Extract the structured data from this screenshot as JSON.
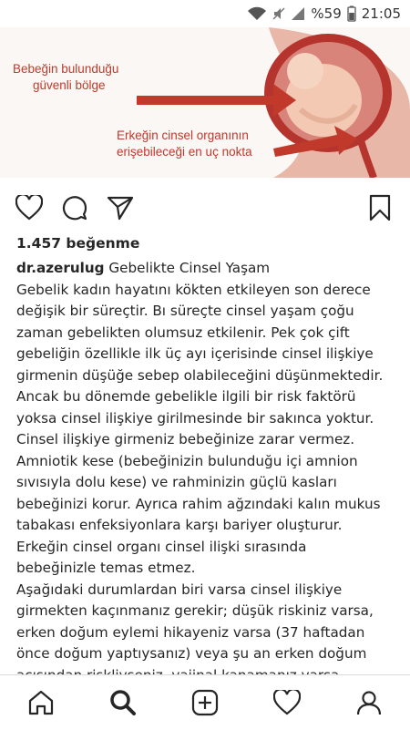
{
  "status_bar": {
    "battery_text": "%59",
    "time": "21:05",
    "icons": [
      "wifi-icon",
      "mute-icon",
      "signal-icon",
      "battery-icon"
    ]
  },
  "post_image": {
    "label_safe_zone": [
      "Bebeğin bulunduğu",
      "güvenli bölge"
    ],
    "label_reach_point": [
      "Erkeğin cinsel organının",
      "erişebileceği en uç nokta"
    ],
    "arrow_color": "#c0392b"
  },
  "actions": {
    "icons": [
      "heart-icon",
      "comment-icon",
      "share-icon",
      "bookmark-icon"
    ]
  },
  "likes_text": "1.457 beğenme",
  "caption": {
    "username": "dr.azerulug",
    "title": "Gebelikte Cinsel Yaşam",
    "lines": [
      "Gebelik kadın hayatını kökten etkileyen son derece",
      "değişik bir süreçtir. Bı süreçte cinsel yaşam çoğu",
      "zaman gebelikten olumsuz etkilenir. Pek çok çift",
      "gebeliğin özellikle ilk üç ayı içerisinde cinsel ilişkiye",
      "girmenin düşüğe sebep olabileceğini düşünmektedir.",
      "Ancak bu dönemde gebelikle ilgili bir risk faktörü",
      "yoksa cinsel ilişkiye girilmesinde bir sakınca yoktur.",
      "Cinsel ilişkiye girmeniz bebeğinize zarar vermez.",
      "Amniotik kese (bebeğinizin bulunduğu içi amnion",
      "sıvısıyla dolu kese) ve rahminizin güçlü kasları",
      "bebeğinizi korur. Ayrıca rahim ağzındaki kalın mukus",
      "tabakası enfeksiyonlara karşı bariyer oluşturur.",
      "Erkeğin cinsel organı cinsel ilişki sırasında",
      "bebeğinizle temas etmez.",
      "Aşağıdaki durumlardan biri varsa cinsel ilişkiye",
      "girmekten kaçınmanız gerekir;  düşük riskiniz varsa,",
      "erken doğum eylemi hikayeniz varsa (37 haftadan",
      "önce doğum yaptıysanız) veya  şu an erken doğum",
      "açısından riskliyseniz, vajinal kanamanız varsa,"
    ]
  },
  "bottom_nav": {
    "icons": [
      "home-icon",
      "search-icon",
      "add-post-icon",
      "activity-heart-icon",
      "profile-icon"
    ]
  }
}
